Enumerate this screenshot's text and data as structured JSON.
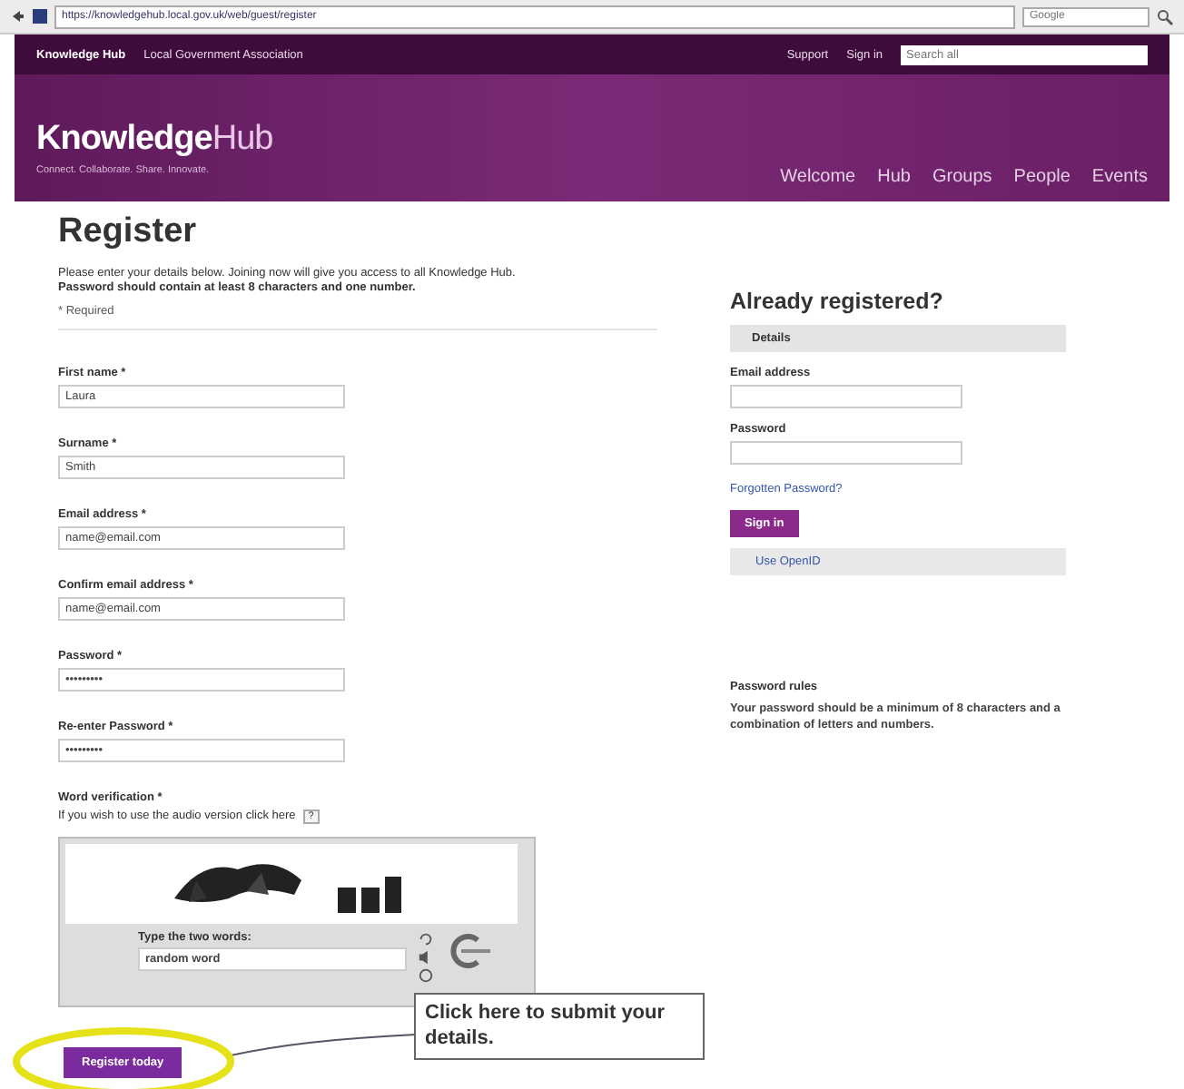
{
  "browser": {
    "address": "https://knowledgehub.local.gov.uk/web/guest/register",
    "search_placeholder": "Google"
  },
  "top_bar": {
    "links": [
      "Knowledge Hub",
      "Local Government Association"
    ],
    "right_links": [
      "Support",
      "Sign in"
    ],
    "search_placeholder": "Search all"
  },
  "header": {
    "logo_bold": "Knowledge",
    "logo_light": "Hub",
    "tagline": "Connect. Collaborate. Share. Innovate.",
    "nav": [
      "Welcome",
      "Hub",
      "Groups",
      "People",
      "Events"
    ]
  },
  "register": {
    "title": "Register",
    "intro": "Please enter your details below. Joining now will give you access to all Knowledge Hub.",
    "note": "Password should contain at least 8 characters and one number.",
    "required": "* Required",
    "fields": [
      {
        "label": "First name *",
        "value": "Laura"
      },
      {
        "label": "Surname *",
        "value": "Smith"
      },
      {
        "label": "Email address *",
        "value": "name@email.com"
      },
      {
        "label": "Confirm email address *",
        "value": "name@email.com"
      },
      {
        "label": "Password *",
        "value": "•••••••••"
      },
      {
        "label": "Re-enter Password *",
        "value": "•••••••••"
      }
    ],
    "verification": {
      "label": "Word verification *",
      "hint": "If you wish to use the audio version click here",
      "help": "?",
      "answer_label": "Type the two words:",
      "answer_value": "random word"
    },
    "submit": "Register today"
  },
  "sign_in": {
    "title": "Already registered?",
    "tab": "Details",
    "fields": [
      {
        "label": "Email address"
      },
      {
        "label": "Password"
      }
    ],
    "forgot": "Forgotten Password?",
    "button": "Sign in",
    "openid": "Use OpenID"
  },
  "password_rules": {
    "title": "Password rules",
    "text": "Your password should be a minimum of 8 characters and a combination of letters and numbers."
  },
  "callout": "Click here to submit your details."
}
